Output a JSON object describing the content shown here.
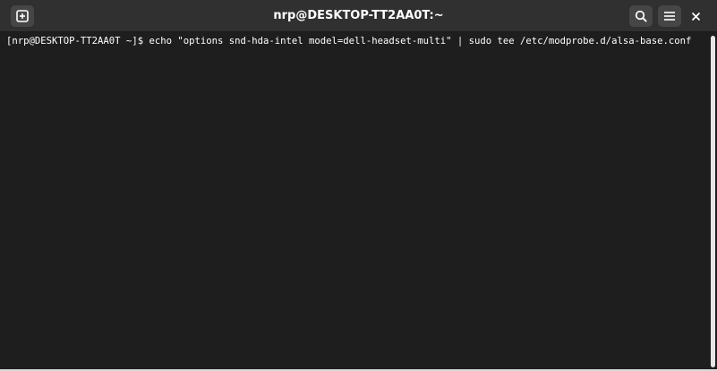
{
  "window": {
    "title": "nrp@DESKTOP-TT2AA0T:~"
  },
  "header": {
    "new_tab_icon": "new-tab-icon",
    "search_icon": "search-icon",
    "menu_icon": "hamburger-menu-icon",
    "close_icon": "close-icon"
  },
  "terminal": {
    "prompt": "[nrp@DESKTOP-TT2AA0T ~]$ ",
    "command": "echo \"options snd-hda-intel model=dell-headset-multi\" | sudo tee /etc/modprobe.d/alsa-base.conf"
  },
  "colors": {
    "background": "#1e1e1e",
    "headerbar": "#303030",
    "text": "#ffffff"
  }
}
